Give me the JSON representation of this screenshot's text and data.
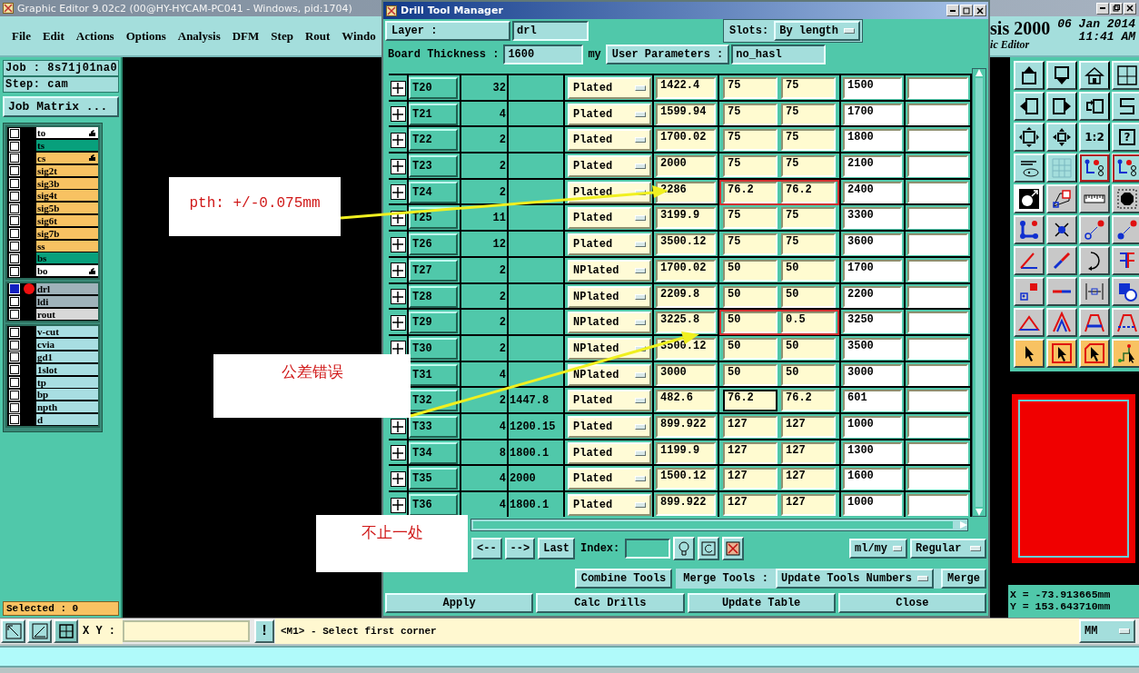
{
  "window": {
    "title": "Graphic Editor 9.02c2 (00@HY-HYCAM-PC041 - Windows, pid:1704)"
  },
  "menu": [
    "File",
    "Edit",
    "Actions",
    "Options",
    "Analysis",
    "DFM",
    "Step",
    "Rout",
    "Windo"
  ],
  "branding": {
    "logo": "sis 2000",
    "subtitle": "ic Editor",
    "date": "06 Jan 2014",
    "time": "11:41 AM"
  },
  "job": {
    "job": "Job : 8s71j01na0",
    "step": "Step: cam",
    "matrix_button": "Job Matrix ..."
  },
  "layer_groups": [
    [
      {
        "name": "to",
        "color": "#ffffff",
        "pointer": true,
        "active": false
      },
      {
        "name": "ts",
        "color": "#08a07c",
        "pointer": false,
        "active": false
      },
      {
        "name": "cs",
        "color": "#f8c262",
        "pointer": true,
        "active": false
      },
      {
        "name": "sig2t",
        "color": "#f8c262",
        "pointer": false,
        "active": false
      },
      {
        "name": "sig3b",
        "color": "#f8c262",
        "pointer": false,
        "active": false
      },
      {
        "name": "sig4t",
        "color": "#f8c262",
        "pointer": false,
        "active": false
      },
      {
        "name": "sig5b",
        "color": "#f8c262",
        "pointer": false,
        "active": false
      },
      {
        "name": "sig6t",
        "color": "#f8c262",
        "pointer": false,
        "active": false
      },
      {
        "name": "sig7b",
        "color": "#f8c262",
        "pointer": false,
        "active": false
      },
      {
        "name": "ss",
        "color": "#f8c262",
        "pointer": false,
        "active": false
      },
      {
        "name": "bs",
        "color": "#08a07c",
        "pointer": false,
        "active": false
      },
      {
        "name": "bo",
        "color": "#ffffff",
        "pointer": true,
        "active": false
      }
    ],
    [
      {
        "name": "drl",
        "color": "#9fb2ba",
        "pointer": false,
        "active": true
      },
      {
        "name": "ldi",
        "color": "#9fb2ba",
        "pointer": false,
        "active": false
      },
      {
        "name": "rout",
        "color": "#d8d8d8",
        "pointer": false,
        "active": false
      }
    ],
    [
      {
        "name": "v-cut",
        "color": "#a8dee2",
        "pointer": false,
        "active": false
      },
      {
        "name": "cvia",
        "color": "#a8dee2",
        "pointer": false,
        "active": false
      },
      {
        "name": "gd1",
        "color": "#a8dee2",
        "pointer": false,
        "active": false
      },
      {
        "name": "1slot",
        "color": "#a8dee2",
        "pointer": false,
        "active": false
      },
      {
        "name": "tp",
        "color": "#a8dee2",
        "pointer": false,
        "active": false
      },
      {
        "name": "bp",
        "color": "#a8dee2",
        "pointer": false,
        "active": false
      },
      {
        "name": "npth",
        "color": "#a8dee2",
        "pointer": false,
        "active": false
      },
      {
        "name": "d",
        "color": "#a8dee2",
        "pointer": false,
        "active": false
      }
    ]
  ],
  "selected_count": "Selected : 0",
  "toolbox": {
    "scale_label": "1:2",
    "help_label": "?"
  },
  "coords": {
    "x": "X = -73.913665mm",
    "y": "Y = 153.643710mm"
  },
  "bottom_bar": {
    "xy_label": "X Y :",
    "alert_button": "!",
    "message": "<M1> - Select first corner",
    "units": "MM"
  },
  "dialog": {
    "title": "Drill Tool Manager",
    "layer_button": "Layer :",
    "layer_value": "drl",
    "slots_label": "Slots:",
    "slots_value": "By length",
    "thickness_label": "Board Thickness :",
    "thickness_value": "1600",
    "thickness_unit": "my",
    "user_params_button": "User Parameters :",
    "user_params_value": "no_hasl",
    "rows": [
      {
        "tool": "T20",
        "count": "32",
        "type": "Plated",
        "finish": "1422.4",
        "tol_plus": "75",
        "tol_minus": "75",
        "drill": "1500",
        "expand": true,
        "flagged": false,
        "focused": false
      },
      {
        "tool": "T21",
        "count": "4",
        "type": "Plated",
        "finish": "1599.94",
        "tol_plus": "75",
        "tol_minus": "75",
        "drill": "1700",
        "expand": true,
        "flagged": false,
        "focused": false
      },
      {
        "tool": "T22",
        "count": "2",
        "type": "Plated",
        "finish": "1700.02",
        "tol_plus": "75",
        "tol_minus": "75",
        "drill": "1800",
        "expand": true,
        "flagged": false,
        "focused": false
      },
      {
        "tool": "T23",
        "count": "2",
        "type": "Plated",
        "finish": "2000",
        "tol_plus": "75",
        "tol_minus": "75",
        "drill": "2100",
        "expand": true,
        "flagged": false,
        "focused": false
      },
      {
        "tool": "T24",
        "count": "2",
        "type": "Plated",
        "finish": "2286",
        "tol_plus": "76.2",
        "tol_minus": "76.2",
        "drill": "2400",
        "expand": true,
        "flagged": true,
        "focused": false
      },
      {
        "tool": "T25",
        "count": "11",
        "type": "Plated",
        "finish": "3199.9",
        "tol_plus": "75",
        "tol_minus": "75",
        "drill": "3300",
        "expand": true,
        "flagged": false,
        "focused": false
      },
      {
        "tool": "T26",
        "count": "12",
        "type": "Plated",
        "finish": "3500.12",
        "tol_plus": "75",
        "tol_minus": "75",
        "drill": "3600",
        "expand": true,
        "flagged": false,
        "focused": false
      },
      {
        "tool": "T27",
        "count": "2",
        "type": "NPlated",
        "finish": "1700.02",
        "tol_plus": "50",
        "tol_minus": "50",
        "drill": "1700",
        "expand": true,
        "flagged": false,
        "focused": false
      },
      {
        "tool": "T28",
        "count": "2",
        "type": "NPlated",
        "finish": "2209.8",
        "tol_plus": "50",
        "tol_minus": "50",
        "drill": "2200",
        "expand": true,
        "flagged": false,
        "focused": false
      },
      {
        "tool": "T29",
        "count": "2",
        "type": "NPlated",
        "finish": "3225.8",
        "tol_plus": "50",
        "tol_minus": "0.5",
        "drill": "3250",
        "expand": true,
        "flagged": true,
        "focused": false
      },
      {
        "tool": "T30",
        "count": "2",
        "type": "NPlated",
        "finish": "3500.12",
        "tol_plus": "50",
        "tol_minus": "50",
        "drill": "3500",
        "expand": true,
        "flagged": false,
        "focused": false
      },
      {
        "tool": "T31",
        "count": "4",
        "type": "NPlated",
        "finish": "3000",
        "tol_plus": "50",
        "tol_minus": "50",
        "drill": "3000",
        "flagged": false,
        "focused": false
      },
      {
        "tool": "T32",
        "count": "2",
        "column_4": "1447.8",
        "type": "Plated",
        "finish": "482.6",
        "tol_plus": "76.2",
        "tol_minus": "76.2",
        "drill": "601",
        "expand": false,
        "flagged": false,
        "focused": true
      },
      {
        "tool": "T33",
        "count": "4",
        "column_4": "1200.15",
        "type": "Plated",
        "finish": "899.922",
        "tol_plus": "127",
        "tol_minus": "127",
        "drill": "1000",
        "expand": true,
        "flagged": false,
        "focused": false
      },
      {
        "tool": "T34",
        "count": "8",
        "column_4": "1800.1",
        "type": "Plated",
        "finish": "1199.9",
        "tol_plus": "127",
        "tol_minus": "127",
        "drill": "1300",
        "expand": true,
        "flagged": false,
        "focused": false
      },
      {
        "tool": "T35",
        "count": "4",
        "column_4": "2000",
        "type": "Plated",
        "finish": "1500.12",
        "tol_plus": "127",
        "tol_minus": "127",
        "drill": "1600",
        "expand": true,
        "flagged": false,
        "focused": false
      },
      {
        "tool": "T36",
        "count": "4",
        "column_4": "1800.1",
        "type": "Plated",
        "finish": "899.922",
        "tol_plus": "127",
        "tol_minus": "127",
        "drill": "1000",
        "expand": true,
        "flagged": false,
        "focused": false
      }
    ],
    "nav_buttons": [
      "<--",
      "-->",
      "Last"
    ],
    "index_label": "Index:",
    "units": "ml/my",
    "mode": "Regular",
    "combine_button": "Combine Tools",
    "merge_label": "Merge Tools :",
    "merge_mode": "Update Tools Numbers",
    "merge_button": "Merge",
    "actions": [
      "Apply",
      "Calc Drills",
      "Update Table",
      "Close"
    ]
  },
  "annotations": [
    {
      "text": "pth: +/-0.075mm"
    },
    {
      "text": "公差错误"
    },
    {
      "text": "不止一处"
    }
  ]
}
